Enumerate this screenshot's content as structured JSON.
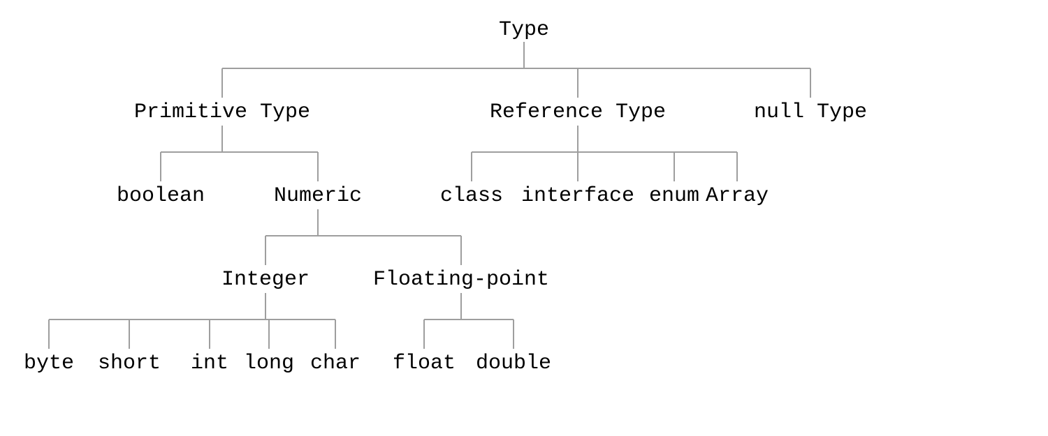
{
  "nodes": {
    "root": "Type",
    "primitive": "Primitive Type",
    "reference": "Reference Type",
    "nulltype": "null Type",
    "boolean": "boolean",
    "numeric": "Numeric",
    "class": "class",
    "interface": "interface",
    "enum": "enum",
    "array": "Array",
    "integer": "Integer",
    "floating": "Floating-point",
    "byte": "byte",
    "short": "short",
    "int": "int",
    "long": "long",
    "char": "char",
    "float": "float",
    "double": "double"
  }
}
